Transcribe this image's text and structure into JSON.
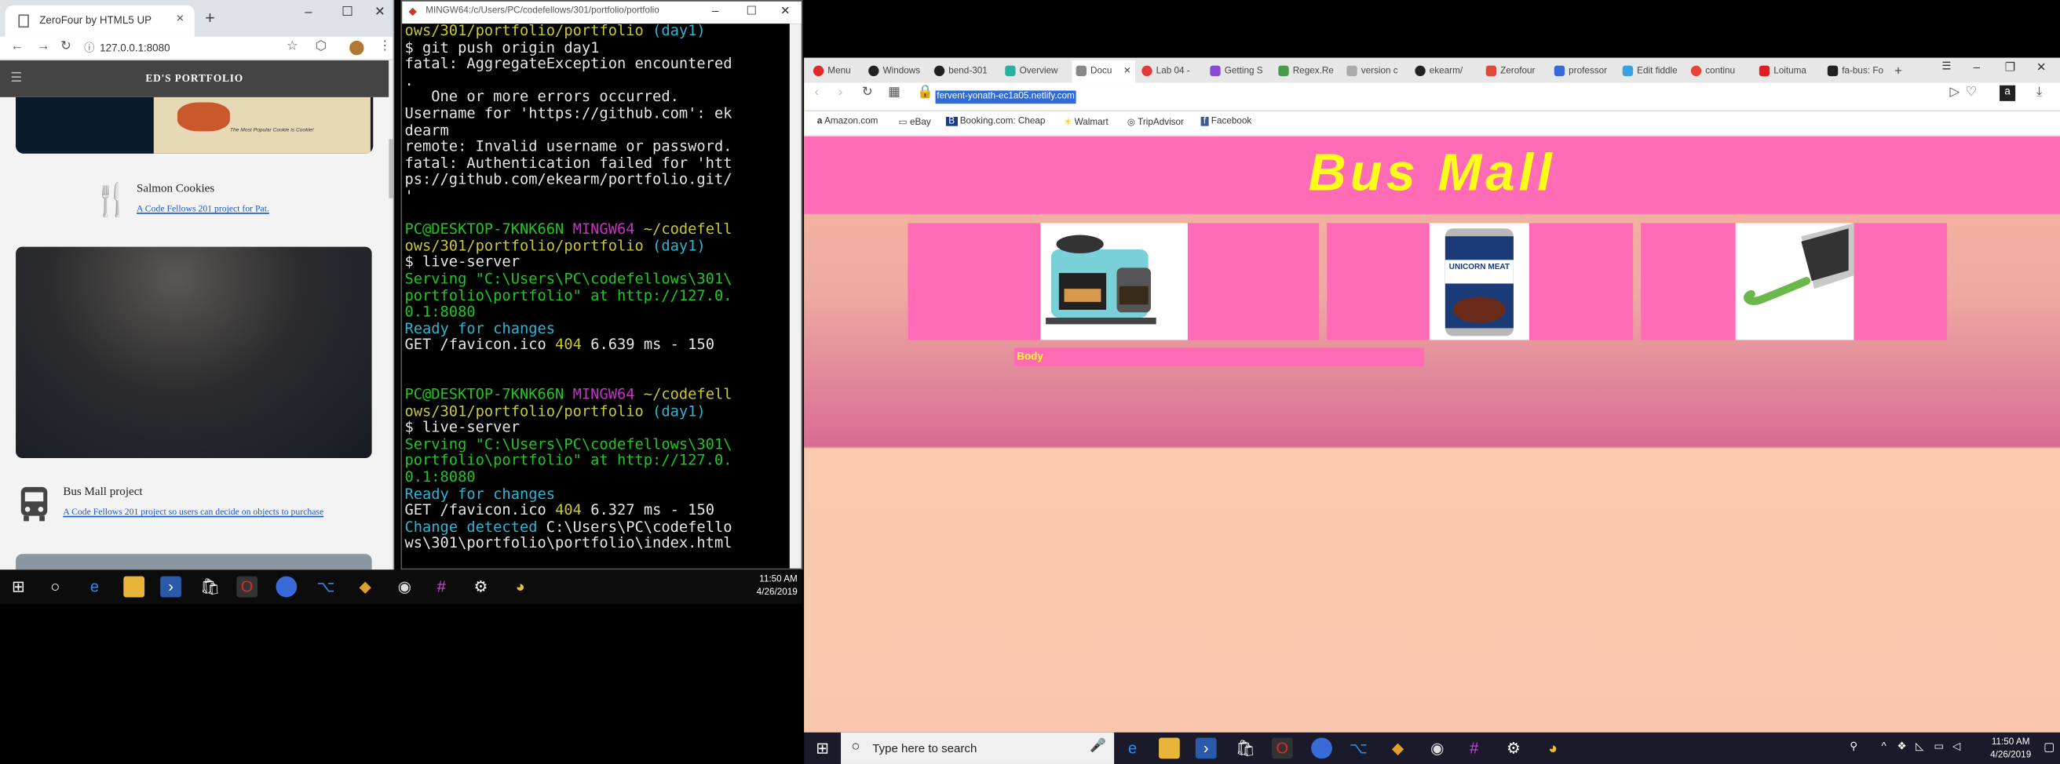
{
  "chrome": {
    "tab_title": "ZeroFour by HTML5 UP",
    "url": "127.0.0.1:8080",
    "site_title": "ED'S PORTFOLIO",
    "item1_title": "Salmon Cookies",
    "item1_link": "A Code Fellows 201 project for Pat.",
    "item2_title": "Bus Mall project",
    "item2_link": "A Code Fellows 201 project so users can decide on objects to purchase",
    "thumb_caption": "The Most Popular Cookie is Cookie!"
  },
  "bash": {
    "title": "MINGW64:/c/Users/PC/codefellows/301/portfolio/portfolio",
    "lines": {
      "l1a": "ows/301/portfolio/portfolio ",
      "l1b": "(day1)",
      "l2": "$ git push origin day1",
      "l3": "fatal: AggregateException encountered",
      "l4": ".",
      "l5": "   One or more errors occurred.",
      "l6": "Username for 'https://github.com': ek",
      "l7": "dearm",
      "l8": "remote: Invalid username or password.",
      "l9": "fatal: Authentication failed for 'htt",
      "l10": "ps://github.com/ekearm/portfolio.git/",
      "l11": "'",
      "p1a": "PC@DESKTOP-7KNK66N ",
      "p1b": "MINGW64 ",
      "p1c": "~/codefell",
      "p1d": "ows/301/portfolio/portfolio ",
      "p1e": "(day1)",
      "cmd1": "$ live-server",
      "s1": "Serving \"C:\\Users\\PC\\codefellows\\301\\",
      "s2": "portfolio\\portfolio\" at http://127.0.",
      "s3": "0.1:8080",
      "ready1": "Ready for changes",
      "get1a": "GET /favicon.ico ",
      "get1b": "404",
      "get1c": " 6.639 ms - 150",
      "p2a": "PC@DESKTOP-7KNK66N ",
      "p2b": "MINGW64 ",
      "p2c": "~/codefell",
      "p2d": "ows/301/portfolio/portfolio ",
      "p2e": "(day1)",
      "cmd2": "$ live-server",
      "s4": "Serving \"C:\\Users\\PC\\codefellows\\301\\",
      "s5": "portfolio\\portfolio\" at http://127.0.",
      "s6": "0.1:8080",
      "ready2": "Ready for changes",
      "get2a": "GET /favicon.ico ",
      "get2b": "404",
      "get2c": " 6.327 ms - 150",
      "chg1a": "Change detected ",
      "chg1b": "C:\\Users\\PC\\codefello",
      "chg2": "ws\\301\\portfolio\\portfolio\\index.html"
    }
  },
  "taskbar_small": {
    "time": "11:50 AM",
    "date": "4/26/2019"
  },
  "opera": {
    "tabs": [
      "Menu",
      "Windows",
      "bend-301",
      "Overview",
      "Docu",
      "Lab 04 -",
      "Getting S",
      "Regex.Re",
      "version c",
      "ekearm/",
      "Zerofour",
      "professor",
      "Edit fiddle",
      "continu",
      "Loituma",
      "fa-bus: Fo"
    ],
    "url": "fervent-yonath-ec1a05.netlify.com",
    "bookmarks": [
      "Amazon.com",
      "eBay",
      "Booking.com: Cheap",
      "Walmart",
      "TripAdvisor",
      "Facebook"
    ],
    "page_title": "Bus Mall",
    "body_label": "Body",
    "can_label": "UNICORN MEAT"
  },
  "taskbar": {
    "search_placeholder": "Type here to search",
    "time": "11:50 AM",
    "date": "4/26/2019"
  }
}
